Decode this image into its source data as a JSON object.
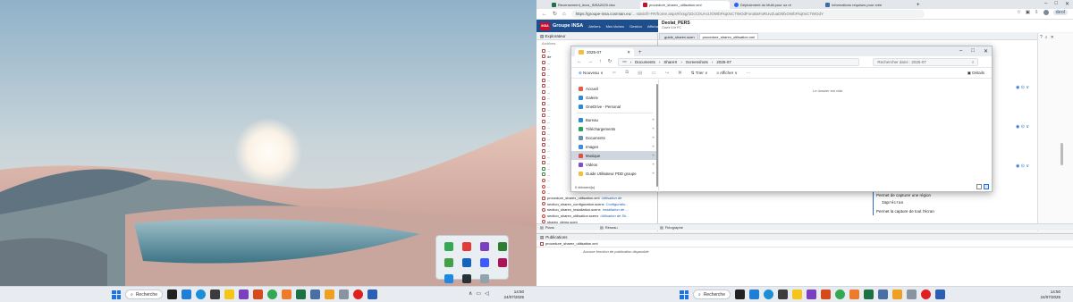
{
  "left_taskbar": {
    "search_label": "Recherche",
    "time": "14:50",
    "date": "24/07/2025"
  },
  "right_taskbar": {
    "search_label": "Recherche",
    "time": "14:50",
    "date": "24/07/2025"
  },
  "browser": {
    "tabs": [
      {
        "label": "Recensement_docs_INSA2025.xlsx",
        "color": "#1e7145"
      },
      {
        "label": "procedure_sharex_utilisation.xml",
        "color": "#c8102e"
      },
      {
        "label": "Déploiement du Multi pour un ré",
        "color": "#2962ff"
      },
      {
        "label": "Informations requises pour crée",
        "color": "#3a6ea5"
      }
    ],
    "url_prefix": "https://groupe-insa.cosmian.eu",
    "url_rest": "/... static/fr-FR/home.aspx#/ixsg/1DcC0UAcIJOWbFkq0xC7WOdFxruBaFaRUvZuaD6fxOWbFkq0xC7WOdY",
    "profile_label": "deol"
  },
  "app": {
    "logo_text": "INSA",
    "brand": "Groupe INSA",
    "menus": [
      "Ateliers",
      "Mes tâches",
      "Gestion",
      "Affichage"
    ],
    "doc_title": "Deolat_PERS",
    "doc_state": "Ouvrir 6 le PC"
  },
  "explorer": {
    "title": "Explorateur",
    "toolbar_label": "Archives",
    "items": [
      {
        "label": "...",
        "desc": "",
        "kind": "f"
      },
      {
        "label": "de",
        "desc": "",
        "kind": "f"
      },
      {
        "label": "...",
        "desc": "",
        "kind": "f"
      },
      {
        "label": "...",
        "desc": "",
        "kind": "f"
      },
      {
        "label": "...",
        "desc": "",
        "kind": "f"
      },
      {
        "label": "...",
        "desc": "",
        "kind": "f"
      },
      {
        "label": "...",
        "desc": "",
        "kind": "f"
      },
      {
        "label": "...",
        "desc": "",
        "kind": "f"
      },
      {
        "label": "...",
        "desc": "",
        "kind": "f"
      },
      {
        "label": "...",
        "desc": "",
        "kind": "f"
      },
      {
        "label": "...",
        "desc": "",
        "kind": "f"
      },
      {
        "label": "...",
        "desc": "",
        "kind": "f"
      },
      {
        "label": "...",
        "desc": "",
        "kind": "f"
      },
      {
        "label": "...",
        "desc": "",
        "kind": "f"
      },
      {
        "label": "...",
        "desc": "",
        "kind": "f"
      },
      {
        "label": "...",
        "desc": "",
        "kind": "f"
      },
      {
        "label": "...",
        "desc": "",
        "kind": "f"
      },
      {
        "label": "...",
        "desc": "",
        "kind": "f"
      },
      {
        "label": "...",
        "desc": "",
        "kind": "f"
      },
      {
        "label": "...",
        "desc": "",
        "kind": "f"
      },
      {
        "label": "...",
        "desc": "",
        "kind": "g"
      },
      {
        "label": "...",
        "desc": "",
        "kind": "g"
      },
      {
        "label": "...",
        "desc": "",
        "kind": "r"
      },
      {
        "label": "...",
        "desc": "",
        "kind": "r"
      },
      {
        "label": "...",
        "desc": "",
        "kind": "r"
      },
      {
        "label": "procedure_sharex_utilisation.xml",
        "desc": "Utilisation de",
        "kind": "f"
      },
      {
        "label": "section_sharex_configuration.scenx",
        "desc": "Configuratio...",
        "kind": "r"
      },
      {
        "label": "section_sharex_installation.scenx",
        "desc": "Installation de ...",
        "kind": "r"
      },
      {
        "label": "section_sharex_utilisation.scenx",
        "desc": "Utilisation de Sh...",
        "kind": "r"
      },
      {
        "label": "sharex_demo.scen",
        "desc": "",
        "kind": "r"
      }
    ]
  },
  "editor": {
    "tabs": [
      {
        "label": "guide_sharex.scen"
      },
      {
        "label": "procedure_sharex_utilisation.xml"
      }
    ],
    "lines": [
      {
        "text": "Ctrl + Imprécran",
        "mono": true
      },
      {
        "text": "Permet de capturer une région",
        "mono": false
      },
      {
        "text": "Imprécran",
        "mono": true
      },
      {
        "text": "Permet la capture de tout l'écran",
        "mono": false
      }
    ]
  },
  "bottom": {
    "tabs": [
      "Plans",
      "Réseau",
      "Fiéographe"
    ],
    "publications_title": "Publications",
    "pub_file": "procedure_sharex_utilisation.xml",
    "pub_empty": "Aucune fonction de publication disponible"
  },
  "file_window": {
    "tab_title": "2025-07",
    "path": [
      "Documents",
      "ShareX",
      "Screenshots",
      "2025-07"
    ],
    "search_placeholder": "Rechercher dans : 2025-07",
    "cmd_new": "Nouveau",
    "cmd_sort": "Trier",
    "cmd_view": "Afficher",
    "cmd_more": "···",
    "details_label": "Détails",
    "nav_items": [
      {
        "label": "Accueil",
        "color": "#e85d3b",
        "pinned": false
      },
      {
        "label": "Galerie",
        "color": "#2f88d8",
        "pinned": false
      },
      {
        "label": "OneDrive - Personal",
        "color": "#2f88d8",
        "pinned": false
      },
      {
        "label": "Bureau",
        "color": "#2f88d8",
        "pinned": true
      },
      {
        "label": "Téléchargements",
        "color": "#2f9e62",
        "pinned": true
      },
      {
        "label": "Documents",
        "color": "#6b8fb0",
        "pinned": true
      },
      {
        "label": "Images",
        "color": "#3a8ee6",
        "pinned": true
      },
      {
        "label": "Musique",
        "color": "#e0523a",
        "pinned": true
      },
      {
        "label": "Vidéos",
        "color": "#7a4fd0",
        "pinned": true
      },
      {
        "label": "Guide Utilisateur PDD groupe",
        "color": "#f0c040",
        "pinned": true
      }
    ],
    "item_count": "0 élément(s)",
    "empty_message": "Le dossier est vide."
  }
}
